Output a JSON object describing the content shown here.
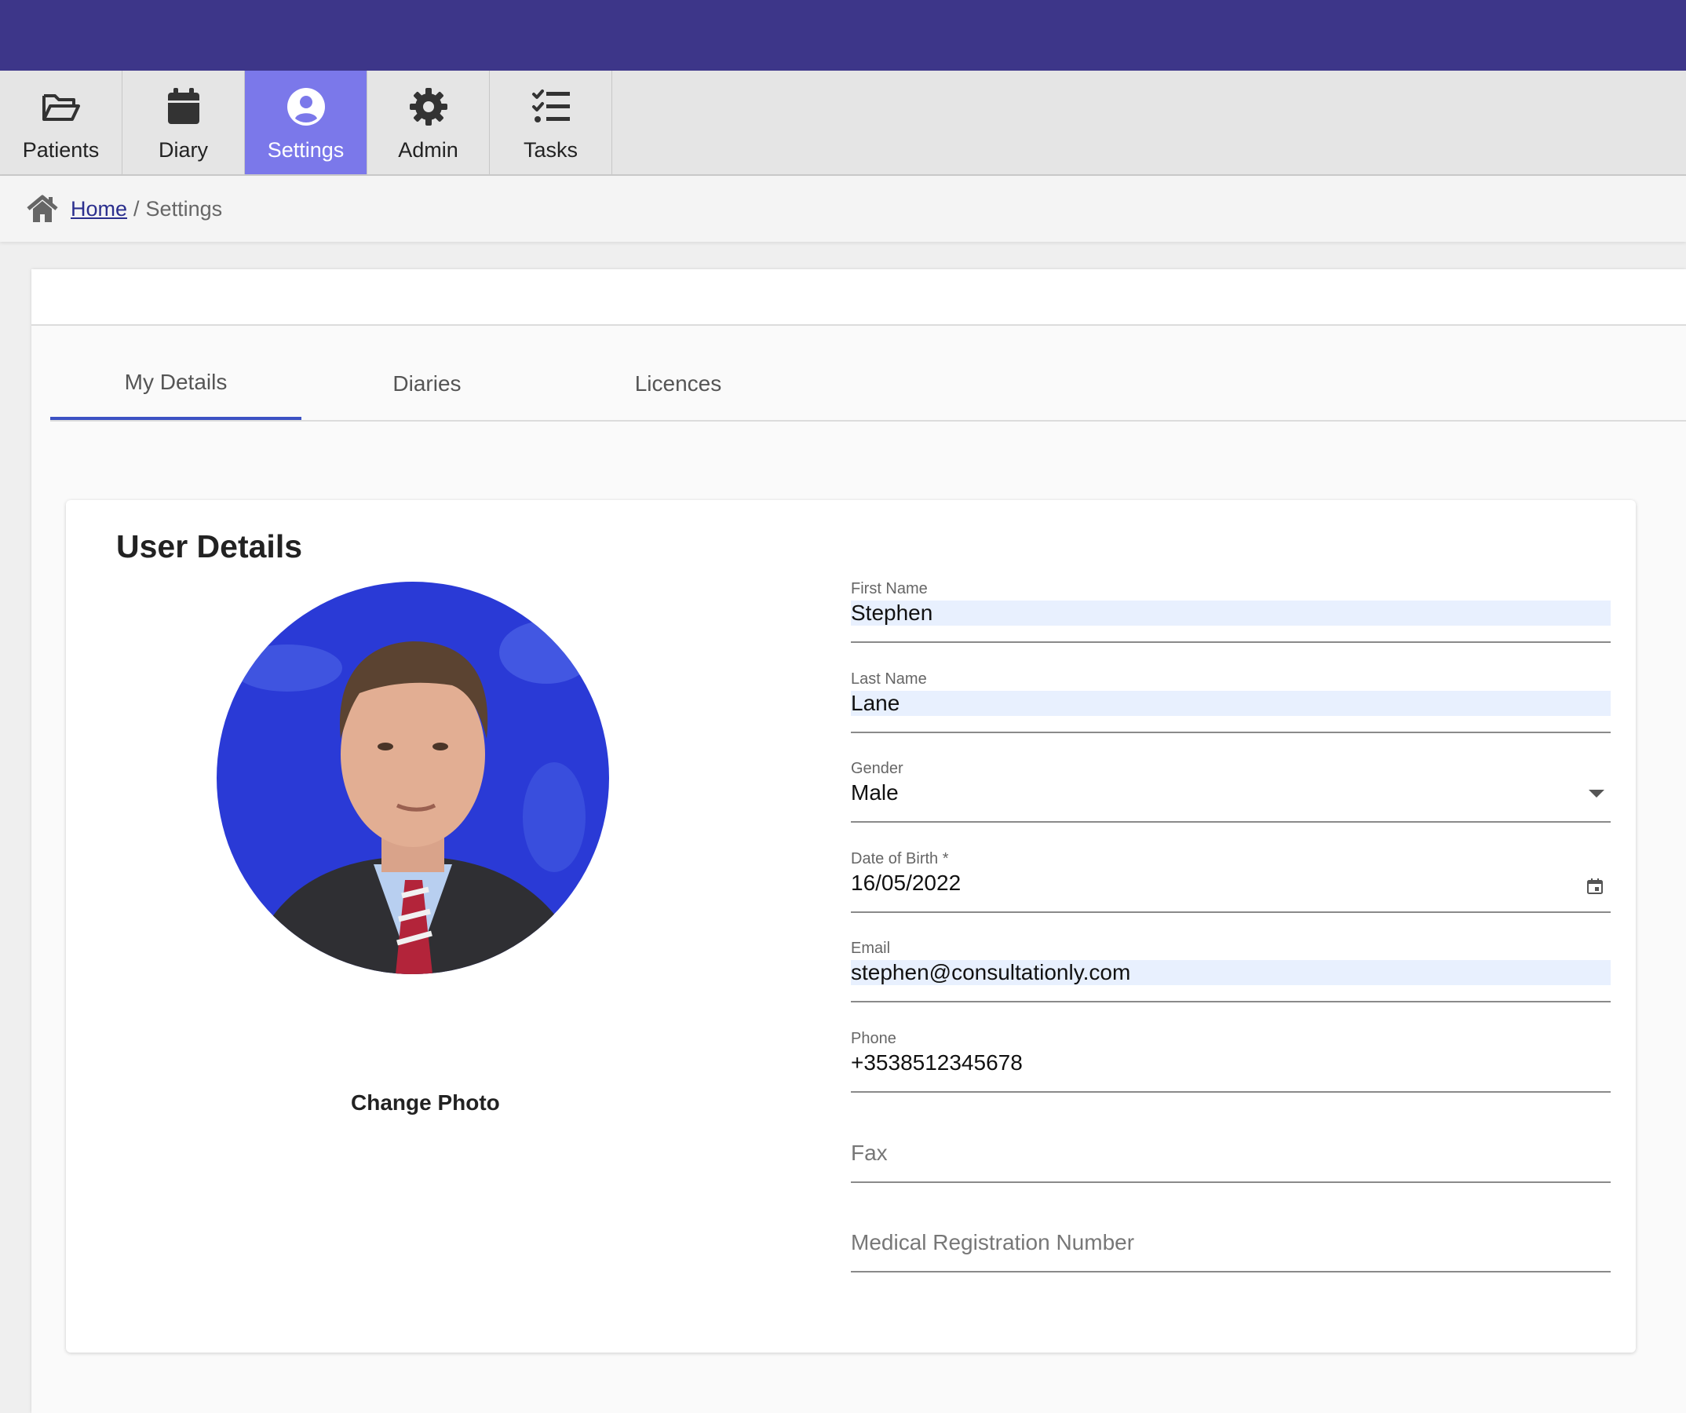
{
  "nav": {
    "tabs": [
      {
        "label": "Patients",
        "icon": "folder-open-icon"
      },
      {
        "label": "Diary",
        "icon": "calendar-icon"
      },
      {
        "label": "Settings",
        "icon": "user-circle-icon"
      },
      {
        "label": "Admin",
        "icon": "gear-icon"
      },
      {
        "label": "Tasks",
        "icon": "tasks-icon"
      }
    ],
    "active": "Settings"
  },
  "breadcrumb": {
    "home_label": "Home",
    "separator": "/",
    "current": "Settings"
  },
  "tabs": {
    "items": [
      {
        "label": "My Details"
      },
      {
        "label": "Diaries"
      },
      {
        "label": "Licences"
      }
    ],
    "active": "My Details"
  },
  "card": {
    "title": "User Details",
    "change_photo_label": "Change Photo"
  },
  "form": {
    "first_name": {
      "label": "First Name",
      "value": "Stephen"
    },
    "last_name": {
      "label": "Last Name",
      "value": "Lane"
    },
    "gender": {
      "label": "Gender",
      "value": "Male"
    },
    "dob": {
      "label": "Date of Birth *",
      "value": "16/05/2022"
    },
    "email": {
      "label": "Email",
      "value": "stephen@consultationly.com"
    },
    "phone": {
      "label": "Phone",
      "value": "+3538512345678"
    },
    "fax": {
      "placeholder": "Fax"
    },
    "mrn": {
      "placeholder": "Medical Registration Number"
    }
  },
  "colors": {
    "topbar": "#3d3689",
    "nav_active": "#7b78ea",
    "tab_indicator": "#3c52c4",
    "autofill": "#e8f0fe"
  }
}
